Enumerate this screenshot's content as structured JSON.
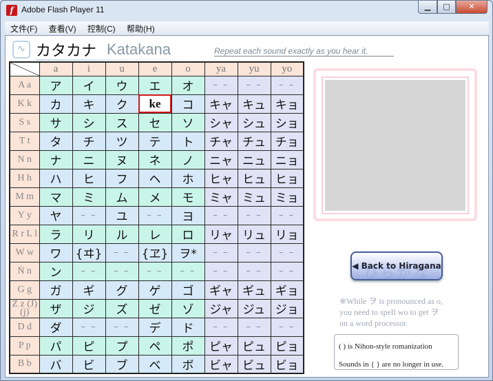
{
  "window": {
    "title": "Adobe Flash Player 11",
    "min_label": "▁",
    "max_label": "□",
    "close_label": "✕"
  },
  "menu": [
    "文件(F)",
    "查看(V)",
    "控制(C)",
    "帮助(H)"
  ],
  "header": {
    "title_jp": "カタカナ",
    "title_en": "Katakana",
    "instruction": "Repeat each sound exactly as you hear it."
  },
  "columns": [
    "a",
    "i",
    "u",
    "e",
    "o",
    "ya",
    "yu",
    "yo"
  ],
  "rows": [
    {
      "label": "A a",
      "cells": [
        "ア",
        "イ",
        "ウ",
        "エ",
        "オ",
        "– –",
        "– –",
        "– –"
      ]
    },
    {
      "label": "K k",
      "cells": [
        "カ",
        "キ",
        "ク",
        "ke",
        "コ",
        "キャ",
        "キュ",
        "キョ"
      ]
    },
    {
      "label": "S s",
      "cells": [
        "サ",
        "シ",
        "ス",
        "セ",
        "ソ",
        "シャ",
        "シュ",
        "ショ"
      ]
    },
    {
      "label": "T t",
      "cells": [
        "タ",
        "チ",
        "ツ",
        "テ",
        "ト",
        "チャ",
        "チュ",
        "チョ"
      ]
    },
    {
      "label": "N n",
      "cells": [
        "ナ",
        "ニ",
        "ヌ",
        "ネ",
        "ノ",
        "ニャ",
        "ニュ",
        "ニョ"
      ]
    },
    {
      "label": "H h",
      "cells": [
        "ハ",
        "ヒ",
        "フ",
        "ヘ",
        "ホ",
        "ヒャ",
        "ヒュ",
        "ヒョ"
      ]
    },
    {
      "label": "M m",
      "cells": [
        "マ",
        "ミ",
        "ム",
        "メ",
        "モ",
        "ミャ",
        "ミュ",
        "ミョ"
      ]
    },
    {
      "label": "Y y",
      "cells": [
        "ヤ",
        "– –",
        "ユ",
        "– –",
        "ヨ",
        "– –",
        "– –",
        "– –"
      ]
    },
    {
      "label": "R r L l",
      "cells": [
        "ラ",
        "リ",
        "ル",
        "レ",
        "ロ",
        "リャ",
        "リュ",
        "リョ"
      ]
    },
    {
      "label": "W w",
      "cells": [
        "ワ",
        "{ヰ}",
        "– –",
        "{ヱ}",
        "ヲ*",
        "– –",
        "– –",
        "– –"
      ]
    },
    {
      "label": "Ṅ n",
      "cells": [
        "ン",
        "– –",
        "– –",
        "– –",
        "– –",
        "– –",
        "– –",
        "– –"
      ]
    },
    {
      "label": "G g",
      "cells": [
        "ガ",
        "ギ",
        "グ",
        "ゲ",
        "ゴ",
        "ギャ",
        "ギュ",
        "ギョ"
      ]
    },
    {
      "label": "Z z (J)(j)",
      "cells": [
        "ザ",
        "ジ",
        "ズ",
        "ゼ",
        "ゾ",
        "ジャ",
        "ジュ",
        "ジョ"
      ]
    },
    {
      "label": "D d",
      "cells": [
        "ダ",
        "– –",
        "– –",
        "デ",
        "ド",
        "– –",
        "– –",
        "– –"
      ]
    },
    {
      "label": "P p",
      "cells": [
        "パ",
        "ピ",
        "プ",
        "ペ",
        "ポ",
        "ピャ",
        "ピュ",
        "ピョ"
      ]
    },
    {
      "label": "B b",
      "cells": [
        "バ",
        "ビ",
        "ブ",
        "ベ",
        "ボ",
        "ビャ",
        "ビュ",
        "ビョ"
      ]
    }
  ],
  "selected_cell": {
    "row": 1,
    "col": 3,
    "text": "ke"
  },
  "back_button": {
    "label": "◀ Back to Hiragana",
    "watermark": "ひらがな"
  },
  "note": {
    "line1": "※While ヲ is pronounced as o,",
    "line2": "you need to spell wo to get ヲ",
    "line3": "on a word processor."
  },
  "legend": {
    "line1": "( ) is Nihon-style romanization",
    "line2": "Sounds in { } are no longer in use."
  },
  "colors": {
    "header_bg": "#fbe4d8",
    "cell_green": "#c9f5e9",
    "cell_blue": "#d6e9f8",
    "cell_violet": "#e0e3f5",
    "selection": "#d01818"
  }
}
